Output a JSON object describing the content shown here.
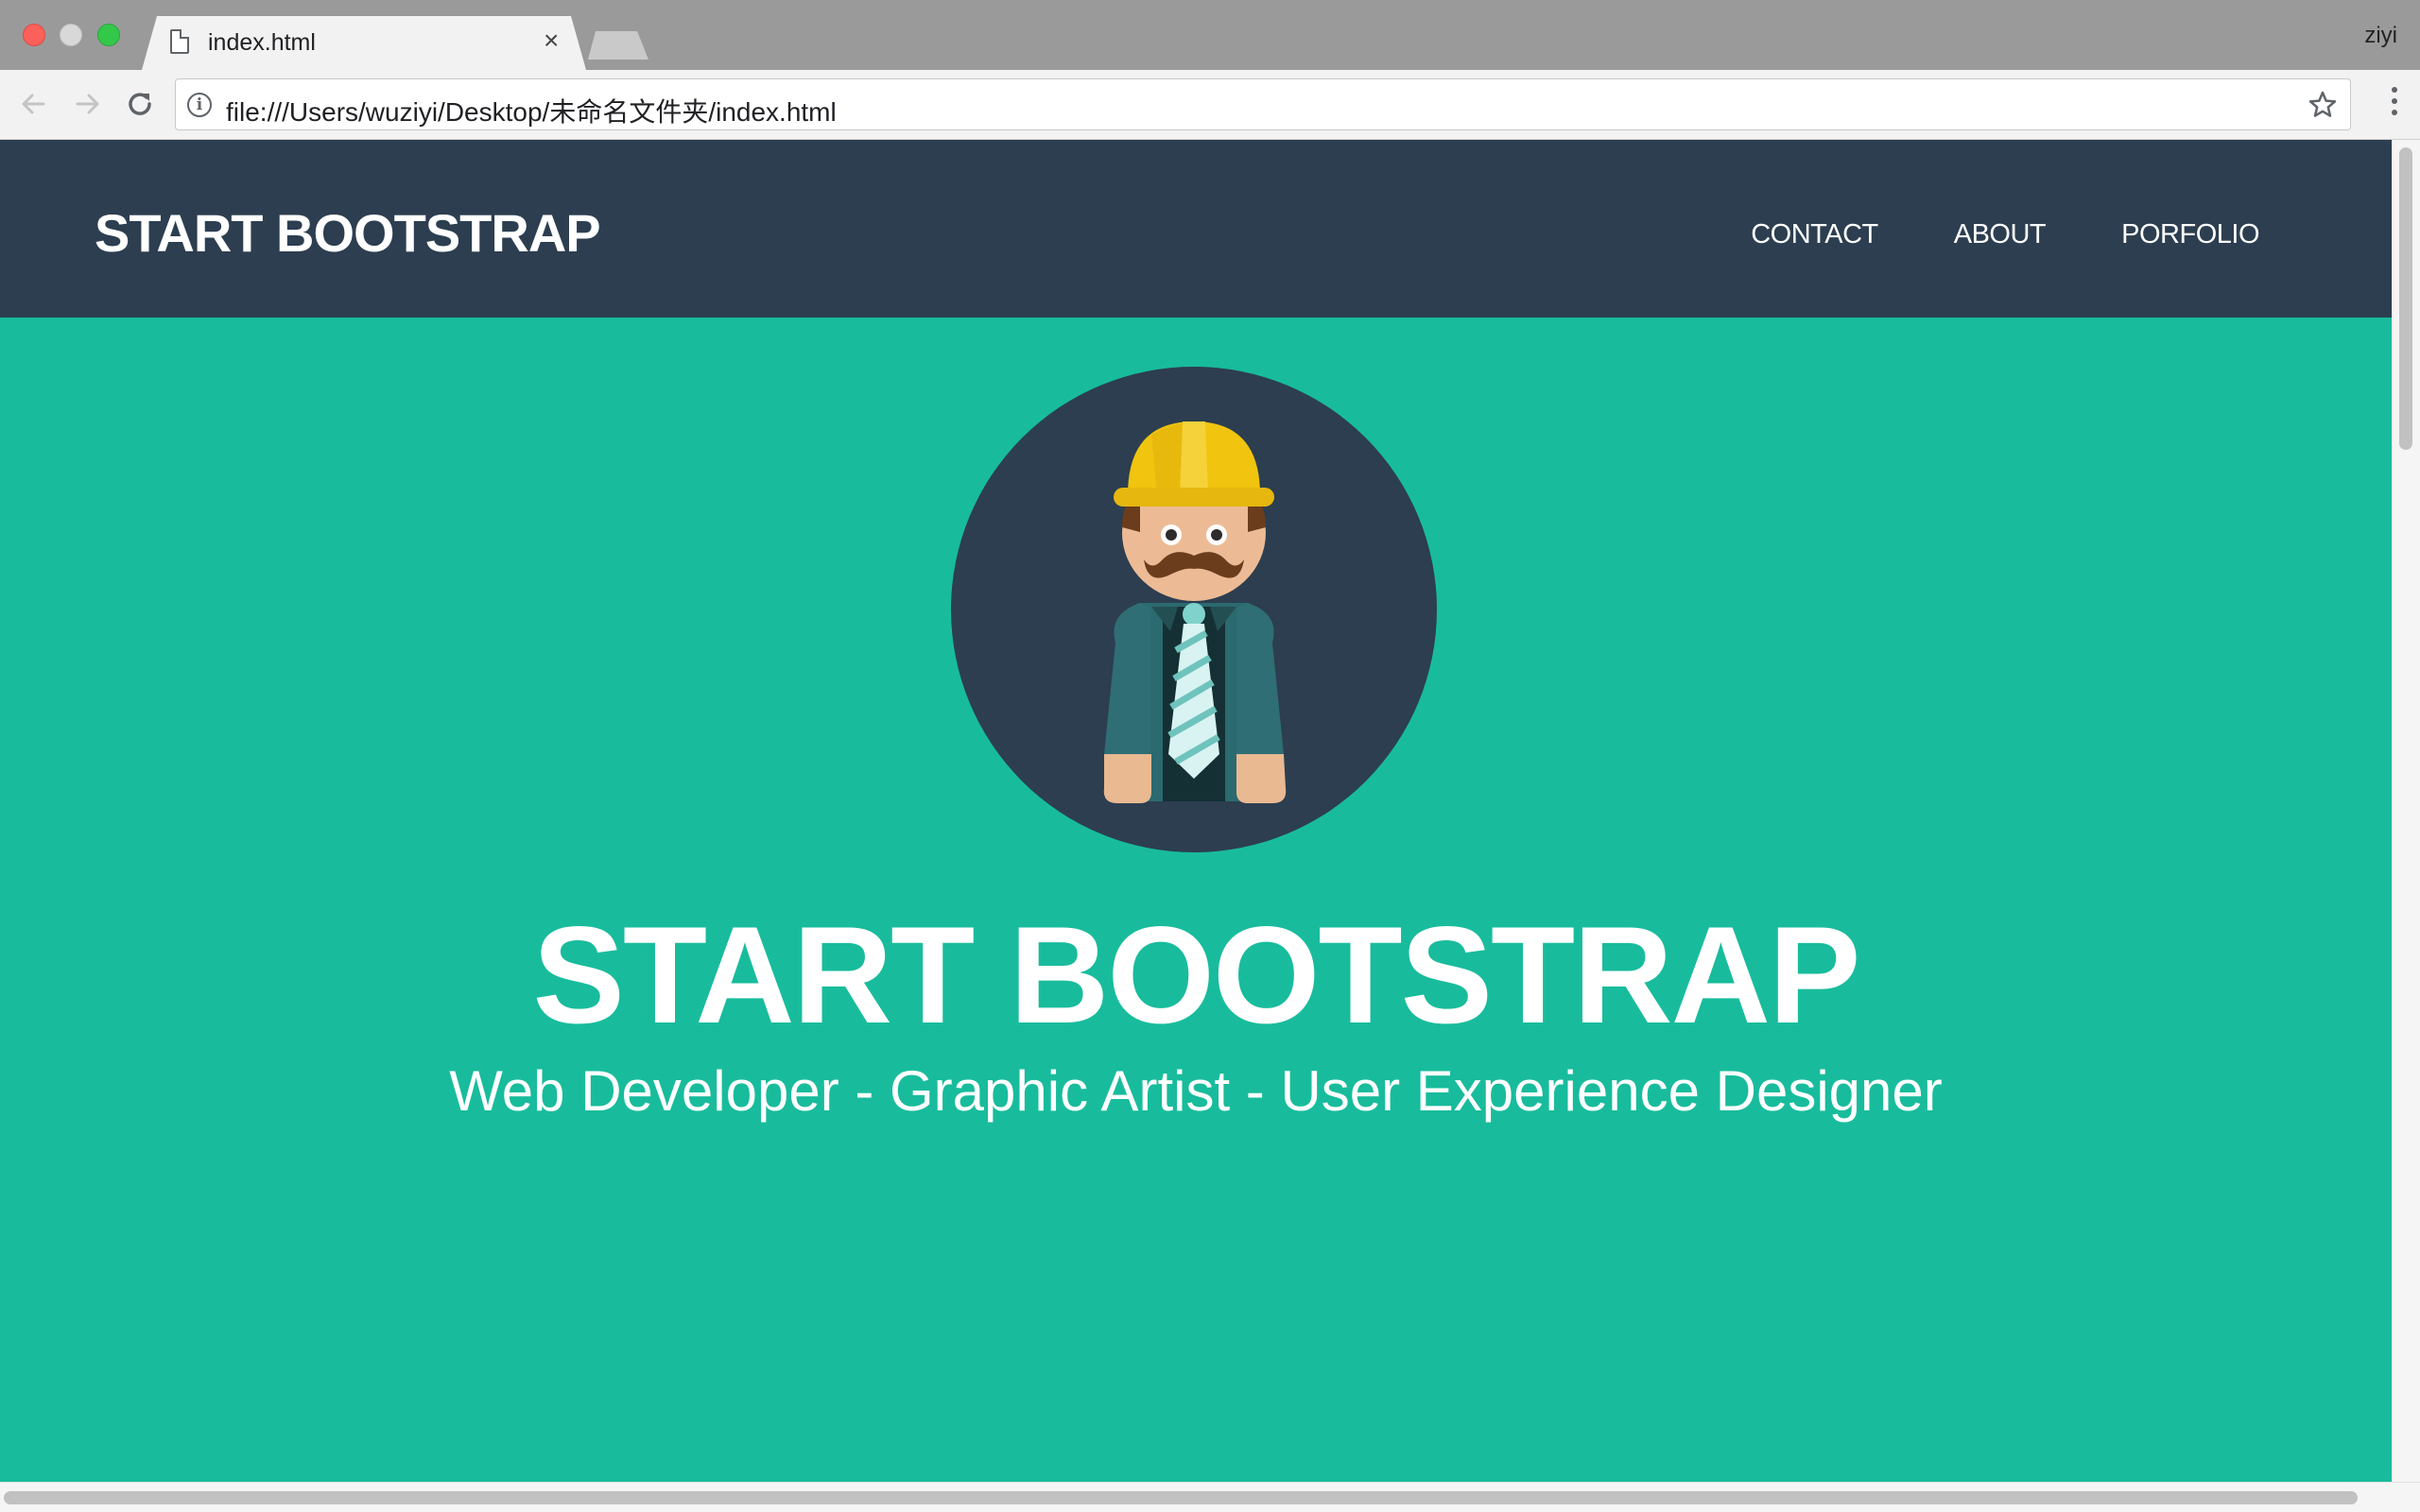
{
  "browser": {
    "tab_title": "index.html",
    "tab_close": "×",
    "profile_name": "ziyi",
    "url": "file:///Users/wuziyi/Desktop/未命名文件夹/index.html",
    "info_icon_glyph": "i"
  },
  "site": {
    "brand": "START BOOTSTRAP",
    "nav": [
      {
        "label": "CONTACT"
      },
      {
        "label": "ABOUT"
      },
      {
        "label": "PORFOLIO"
      }
    ],
    "hero_title": "START BOOTSTRAP",
    "hero_subtitle": "Web Developer - Graphic Artist - User Experience Designer"
  },
  "colors": {
    "nav_bg": "#2c3e50",
    "hero_bg": "#18bc9c",
    "text": "#ffffff"
  },
  "icons": {
    "avatar": "construction-worker-avatar-icon",
    "back": "arrow-left-icon",
    "forward": "arrow-right-icon",
    "reload": "reload-icon",
    "bookmark": "star-icon",
    "menu": "vertical-dots-menu-icon",
    "document": "document-icon"
  }
}
